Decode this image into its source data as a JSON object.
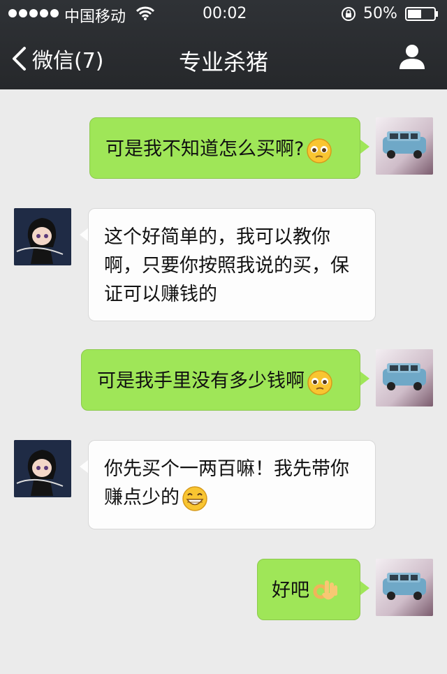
{
  "status_bar": {
    "carrier": "中国移动",
    "time": "00:02",
    "battery": "50%",
    "icons": [
      "signal-dots",
      "wifi-icon",
      "rotation-lock-icon",
      "battery-icon"
    ]
  },
  "nav": {
    "back_label": "微信(7)",
    "title": "专业杀猪",
    "icons": [
      "chevron-left-icon",
      "profile-icon"
    ]
  },
  "messages": [
    {
      "side": "me",
      "text": "可是我不知道怎么买啊?",
      "emoji": "pleading-face-emoji"
    },
    {
      "side": "other",
      "lines": [
        "这个好简单的，我可以教你",
        "啊，只要你按照我说的买，保",
        "证可以赚钱的"
      ]
    },
    {
      "side": "me",
      "text": "可是我手里没有多少钱啊",
      "emoji": "pleading-face-emoji"
    },
    {
      "side": "other",
      "lines": [
        "你先买个一两百嘛！我先带你",
        "赚点少的"
      ],
      "emoji": "grinning-face-emoji"
    },
    {
      "side": "me",
      "text": "好吧",
      "emoji": "ok-hand-emoji"
    }
  ],
  "colors": {
    "header_bg": "#2b2d30",
    "chat_bg": "#ebebeb",
    "my_bubble": "#9fe658",
    "their_bubble": "#fdfdfd"
  }
}
